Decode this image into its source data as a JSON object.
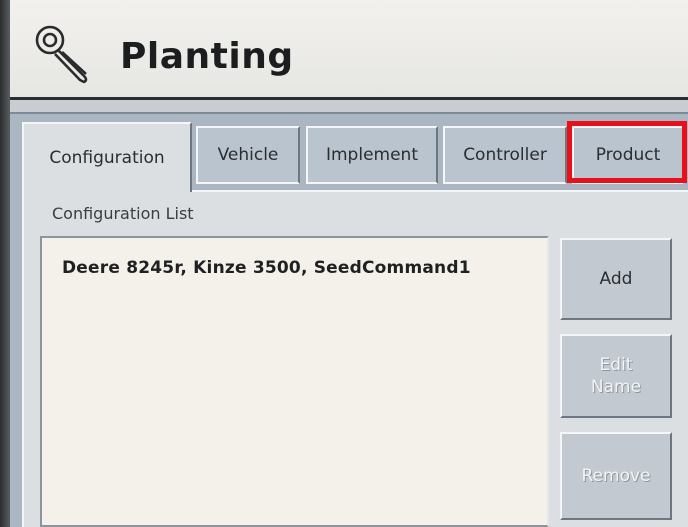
{
  "header": {
    "title": "Planting",
    "icon": "wrench-icon"
  },
  "tabs": [
    {
      "label": "Configuration",
      "active": true
    },
    {
      "label": "Vehicle",
      "active": false
    },
    {
      "label": "Implement",
      "active": false
    },
    {
      "label": "Controller",
      "active": false
    },
    {
      "label": "Product",
      "active": false
    }
  ],
  "configuration": {
    "list_label": "Configuration List",
    "items": [
      "Deere 8245r, Kinze 3500, SeedCommand1"
    ],
    "buttons": {
      "add": "Add",
      "edit_name": "Edit Name",
      "remove": "Remove"
    }
  },
  "colors": {
    "highlight": "#e8101a",
    "tab_active": "#dcdfe2",
    "tab_inactive": "#b9c4cf"
  }
}
